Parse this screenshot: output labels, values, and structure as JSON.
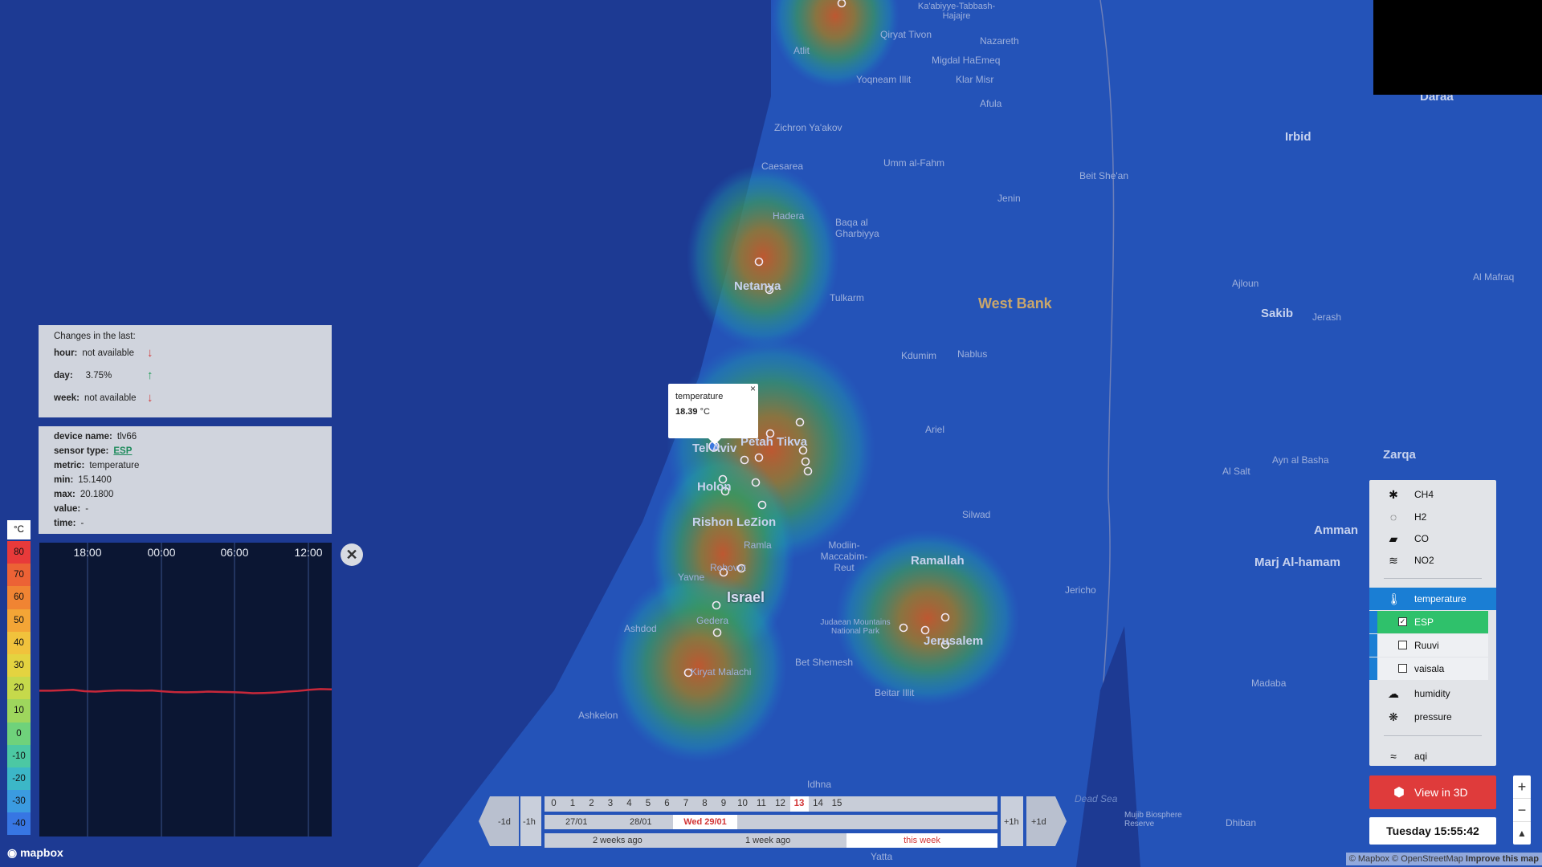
{
  "map": {
    "labels": [
      {
        "text": "Ka'abiyye-Tabbash-Hajajre",
        "cls": "lbl"
      },
      {
        "text": "Qiryat Tivon",
        "cls": "lbl"
      },
      {
        "text": "Nazareth",
        "cls": "lbl"
      },
      {
        "text": "Migdal HaEmeq",
        "cls": "lbl"
      },
      {
        "text": "Atlit",
        "cls": "lbl"
      },
      {
        "text": "Yoqneam Illit",
        "cls": "lbl"
      },
      {
        "text": "Klar Misr",
        "cls": "lbl"
      },
      {
        "text": "Afula",
        "cls": "lbl"
      },
      {
        "text": "Zichron Ya'akov",
        "cls": "lbl"
      },
      {
        "text": "Umm al-Fahm",
        "cls": "lbl"
      },
      {
        "text": "Caesarea",
        "cls": "lbl"
      },
      {
        "text": "Beit She'an",
        "cls": "lbl"
      },
      {
        "text": "Hadera",
        "cls": "lbl"
      },
      {
        "text": "Jenin",
        "cls": "lbl"
      },
      {
        "text": "Baqa al Gharbiyya",
        "cls": "lbl"
      },
      {
        "text": "Netanya",
        "cls": "lbl big"
      },
      {
        "text": "Tulkarm",
        "cls": "lbl"
      },
      {
        "text": "West Bank",
        "cls": "lbl region"
      },
      {
        "text": "Kdumim",
        "cls": "lbl"
      },
      {
        "text": "Nablus",
        "cls": "lbl"
      },
      {
        "text": "Ariel",
        "cls": "lbl"
      },
      {
        "text": "Petah Tikva",
        "cls": "lbl big"
      },
      {
        "text": "Tel Aviv",
        "cls": "lbl big"
      },
      {
        "text": "Holon",
        "cls": "lbl big"
      },
      {
        "text": "Rishon LeZion",
        "cls": "lbl big"
      },
      {
        "text": "Ramla",
        "cls": "lbl"
      },
      {
        "text": "Modiin-Maccabim-Reut",
        "cls": "lbl"
      },
      {
        "text": "Silwad",
        "cls": "lbl"
      },
      {
        "text": "Ramallah",
        "cls": "lbl big"
      },
      {
        "text": "Rehovot",
        "cls": "lbl"
      },
      {
        "text": "Yavne",
        "cls": "lbl"
      },
      {
        "text": "Israel",
        "cls": "lbl country"
      },
      {
        "text": "Ashdod",
        "cls": "lbl"
      },
      {
        "text": "Gedera",
        "cls": "lbl"
      },
      {
        "text": "Judaean Mountains National Park",
        "cls": "lbl"
      },
      {
        "text": "Jerusalem",
        "cls": "lbl big"
      },
      {
        "text": "Jericho",
        "cls": "lbl"
      },
      {
        "text": "Bet Shemesh",
        "cls": "lbl"
      },
      {
        "text": "Kiryat Malachi",
        "cls": "lbl"
      },
      {
        "text": "Beitar Illit",
        "cls": "lbl"
      },
      {
        "text": "Ashkelon",
        "cls": "lbl"
      },
      {
        "text": "Idhna",
        "cls": "lbl"
      },
      {
        "text": "Dead Sea",
        "cls": "lbl water"
      },
      {
        "text": "Yatta",
        "cls": "lbl"
      },
      {
        "text": "Mujib Biosphere Reserve",
        "cls": "lbl"
      },
      {
        "text": "Dhiban",
        "cls": "lbl"
      },
      {
        "text": "Madaba",
        "cls": "lbl"
      },
      {
        "text": "Marj Al-hamam",
        "cls": "lbl big"
      },
      {
        "text": "Amman",
        "cls": "lbl big"
      },
      {
        "text": "Al Salt",
        "cls": "lbl"
      },
      {
        "text": "Ayn al Basha",
        "cls": "lbl"
      },
      {
        "text": "Zarqa",
        "cls": "lbl big"
      },
      {
        "text": "Sakib",
        "cls": "lbl big"
      },
      {
        "text": "Jerash",
        "cls": "lbl"
      },
      {
        "text": "Ajloun",
        "cls": "lbl"
      },
      {
        "text": "Al Mafraq",
        "cls": "lbl"
      },
      {
        "text": "Irbid",
        "cls": "lbl big"
      },
      {
        "text": "Daraa",
        "cls": "lbl big"
      }
    ],
    "attribution": "© Mapbox © OpenStreetMap",
    "improve": "Improve this map",
    "logo": "mapbox"
  },
  "changes": {
    "title": "Changes in the last:",
    "rows": [
      {
        "label": "hour:",
        "value": "not available",
        "dir": "down"
      },
      {
        "label": "day:",
        "value": "3.75%",
        "dir": "up"
      },
      {
        "label": "week:",
        "value": "not available",
        "dir": "down"
      }
    ]
  },
  "device": {
    "rows": [
      {
        "label": "device name:",
        "value": "tlv66"
      },
      {
        "label": "sensor type:",
        "value": "ESP",
        "link": true
      },
      {
        "label": "metric:",
        "value": "temperature"
      },
      {
        "label": "min:",
        "value": "15.1400"
      },
      {
        "label": "max:",
        "value": "20.1800"
      },
      {
        "label": "value:",
        "value": "-"
      },
      {
        "label": "time:",
        "value": "-"
      }
    ]
  },
  "legend": {
    "unit": "°C",
    "items": [
      {
        "label": "80",
        "color": "#e83a3a"
      },
      {
        "label": "70",
        "color": "#ec6235"
      },
      {
        "label": "60",
        "color": "#f08433"
      },
      {
        "label": "50",
        "color": "#f3a536"
      },
      {
        "label": "40",
        "color": "#f1c23c"
      },
      {
        "label": "30",
        "color": "#e4d340"
      },
      {
        "label": "20",
        "color": "#c6d94b"
      },
      {
        "label": "10",
        "color": "#9ed65d"
      },
      {
        "label": "0",
        "color": "#6fd27b"
      },
      {
        "label": "-10",
        "color": "#4cc8a3"
      },
      {
        "label": "-20",
        "color": "#3cb7c7"
      },
      {
        "label": "-30",
        "color": "#3b9be0"
      },
      {
        "label": "-40",
        "color": "#3776e3"
      }
    ]
  },
  "chart_data": {
    "type": "line",
    "title": "",
    "x_ticks": [
      "18:00",
      "00:00",
      "06:00",
      "12:00"
    ],
    "ylim": [
      -45,
      85
    ],
    "series": [
      {
        "values": [
          19.5,
          19.5,
          19.7,
          19.9,
          19.3,
          19.1,
          19.4,
          19.6,
          19.6,
          19.5,
          19.6,
          19.2,
          18.9,
          18.8,
          18.9,
          19.1,
          19.0,
          18.9,
          18.7,
          18.4,
          18.5,
          18.7,
          19.1,
          19.4,
          19.9,
          20.2,
          20.1
        ]
      }
    ],
    "color": "#c8283a"
  },
  "popup": {
    "title": "temperature",
    "value": "18.39",
    "unit": "°C",
    "close": "×"
  },
  "layers": {
    "items": [
      {
        "icon": "✱",
        "icon_name": "ch4-icon",
        "label": "CH4"
      },
      {
        "icon": "◌",
        "icon_name": "h2-icon",
        "label": "H2"
      },
      {
        "icon": "▰",
        "icon_name": "co-icon",
        "label": "CO"
      },
      {
        "icon": "≋",
        "icon_name": "no2-icon",
        "label": "NO2"
      },
      {
        "icon": "🌡",
        "icon_name": "thermometer-icon",
        "label": "temperature",
        "active": true
      },
      {
        "label": "ESP",
        "checked": true
      },
      {
        "label": "Ruuvi",
        "checked": false
      },
      {
        "label": "vaisala",
        "checked": false
      },
      {
        "icon": "☁",
        "icon_name": "humidity-icon",
        "label": "humidity"
      },
      {
        "icon": "❋",
        "icon_name": "pressure-icon",
        "label": "pressure"
      },
      {
        "icon": "≈",
        "icon_name": "aqi-icon",
        "label": "aqi"
      }
    ],
    "active_color": "#1a7ed4",
    "checked_color": "#2fc16b"
  },
  "view3d": {
    "label": "View in 3D"
  },
  "clock": {
    "text": "Tuesday 15:55:42"
  },
  "zoom": {
    "plus": "+",
    "minus": "−",
    "compass": "▲"
  },
  "timeline": {
    "hours": [
      "0",
      "1",
      "2",
      "3",
      "4",
      "5",
      "6",
      "7",
      "8",
      "9",
      "10",
      "11",
      "12",
      "13",
      "14",
      "15"
    ],
    "current_hour": "13",
    "dates": [
      "27/01",
      "28/01",
      "Wed 29/01"
    ],
    "current_date": "Wed 29/01",
    "ranges": [
      "2 weeks ago",
      "1 week ago",
      "this week"
    ],
    "minus_day": "-1d",
    "minus_hour": "-1h",
    "plus_hour": "+1h",
    "plus_day": "+1d"
  }
}
